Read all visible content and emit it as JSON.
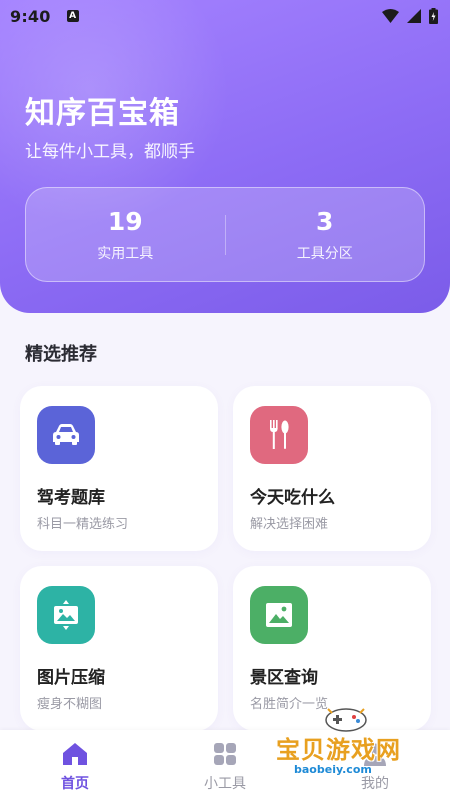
{
  "status_bar": {
    "time": "9:40",
    "a_badge": "A"
  },
  "header": {
    "title": "知序百宝箱",
    "subtitle": "让每件小工具，都顺手",
    "stats": [
      {
        "value": "19",
        "label": "实用工具"
      },
      {
        "value": "3",
        "label": "工具分区"
      }
    ]
  },
  "section": {
    "title": "精选推荐"
  },
  "cards": [
    {
      "title": "驾考题库",
      "desc": "科目一精选练习",
      "icon": "car-icon",
      "color": "#5b64d8"
    },
    {
      "title": "今天吃什么",
      "desc": "解决选择困难",
      "icon": "fork-spoon-icon",
      "color": "#e0697f"
    },
    {
      "title": "图片压缩",
      "desc": "瘦身不糊图",
      "icon": "image-compress-icon",
      "color": "#2db3a5"
    },
    {
      "title": "景区查询",
      "desc": "名胜简介一览",
      "icon": "landscape-icon",
      "color": "#4caf66"
    }
  ],
  "nav": [
    {
      "label": "首页",
      "icon": "home-icon",
      "active": true
    },
    {
      "label": "小工具",
      "icon": "grid-icon",
      "active": false
    },
    {
      "label": "我的",
      "icon": "profile-icon",
      "active": false
    }
  ],
  "watermark": {
    "text": "宝贝游戏网",
    "url": "baobeiy.com"
  },
  "colors": {
    "accent": "#6f52e0",
    "header_start": "#a583ff",
    "header_end": "#7b5ce9"
  }
}
